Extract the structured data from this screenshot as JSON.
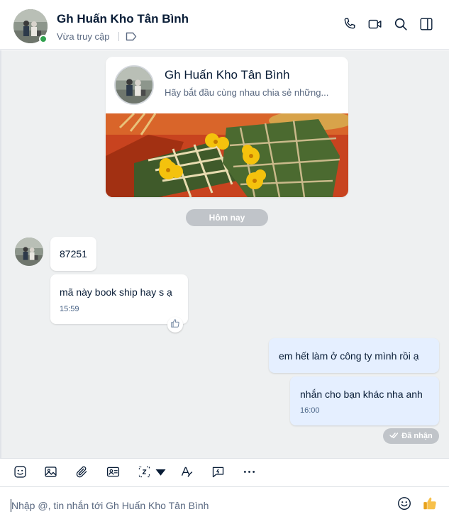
{
  "colors": {
    "accent": "#0068ff",
    "online": "#30a14e",
    "chat_background": "#eef0f1",
    "my_bubble": "#e5efff",
    "pill": "#c0c4c9"
  },
  "header": {
    "contact_name": "Gh Huấn Kho Tân Bình",
    "status": "Vừa truy cập",
    "icons": [
      "phone-icon",
      "video-call-icon",
      "search-icon",
      "sidebar-toggle-icon",
      "tag-icon"
    ]
  },
  "profile_card": {
    "name": "Gh Huấn Kho Tân Bình",
    "description": "Hãy bắt đầu cùng nhau chia sẻ những..."
  },
  "date_separator": "Hôm nay",
  "messages": [
    {
      "from": "contact",
      "text": "87251"
    },
    {
      "from": "contact",
      "text": "mã này book ship hay s ạ",
      "time": "15:59",
      "reaction": "thumbs-up-icon"
    },
    {
      "from": "me",
      "text": "em hết làm ở công ty mình rồi ạ"
    },
    {
      "from": "me",
      "text": "nhắn cho bạn khác nha anh",
      "time": "16:00"
    }
  ],
  "delivery_status": "Đã nhận",
  "toolbar": {
    "icons": [
      "sticker-icon",
      "image-icon",
      "attachment-icon",
      "contact-card-icon",
      "screenshot-icon",
      "chevron-down-icon",
      "text-format-icon",
      "quick-message-icon",
      "more-icon"
    ]
  },
  "composer": {
    "placeholder": "Nhập @, tin nhắn tới Gh Huấn Kho Tân Bình",
    "icons": [
      "emoji-icon",
      "thumbs-up-icon"
    ]
  }
}
